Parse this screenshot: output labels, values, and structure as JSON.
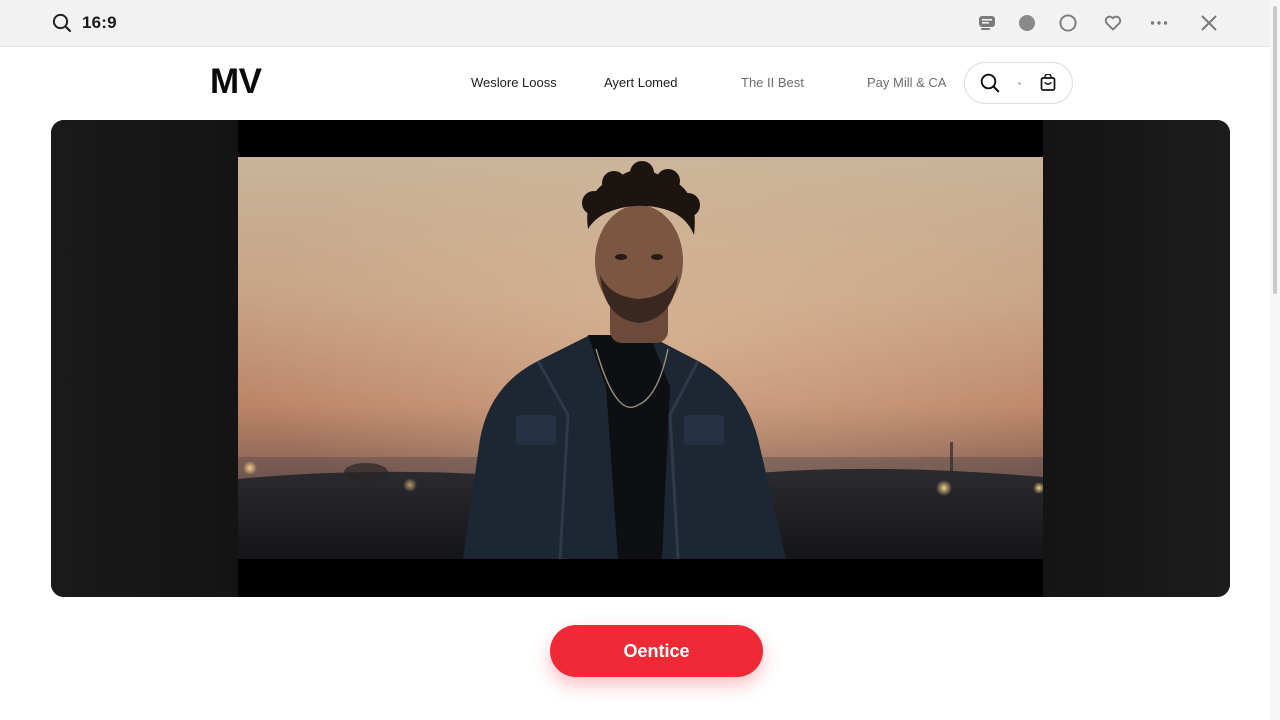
{
  "window": {
    "ratio_label": "16:9",
    "icons": [
      "search-icon",
      "caption-icon",
      "record-dot-icon",
      "circle-icon",
      "heart-icon",
      "more-icon",
      "close-icon"
    ]
  },
  "site": {
    "logo": "MV",
    "nav": [
      {
        "label": "Weslore Looss"
      },
      {
        "label": "Ayert Lomed"
      },
      {
        "label": "The II Best"
      },
      {
        "label": "Pay Mill & CA"
      }
    ],
    "actions": [
      "search-icon",
      "bag-icon"
    ]
  },
  "player": {
    "aspect": "16:9"
  },
  "cta": {
    "label": "Oentice",
    "color": "#ee2a37"
  },
  "colors": {
    "accent": "#ee2a37",
    "topbar": "#f2f2f2",
    "player_bg": "#1b1b1b"
  }
}
